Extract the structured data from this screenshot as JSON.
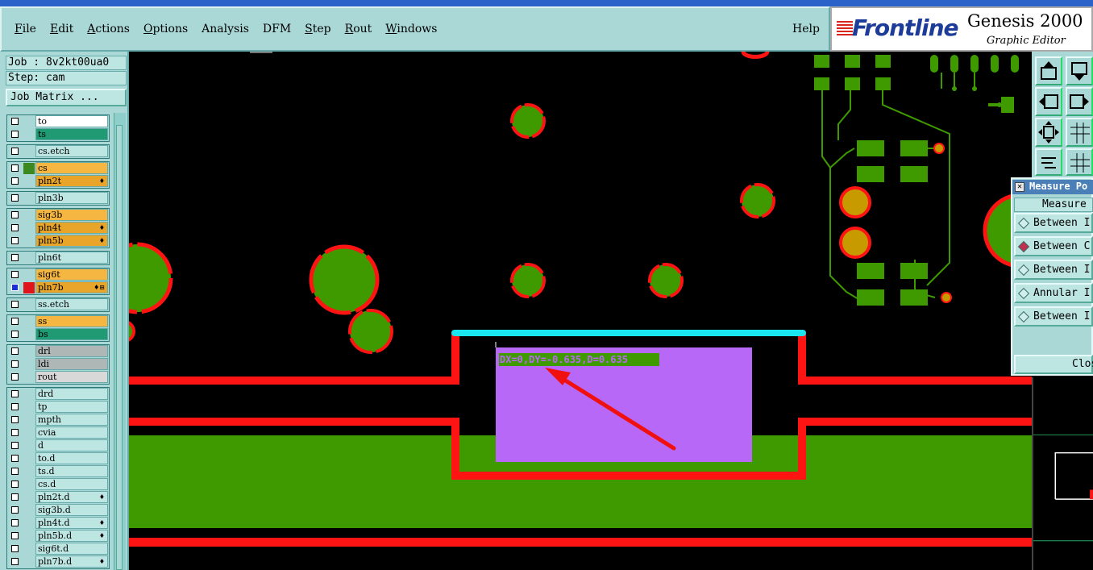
{
  "menubar": {
    "items": [
      {
        "label": "File",
        "u": "F",
        "rest": "ile"
      },
      {
        "label": "Edit",
        "u": "E",
        "rest": "dit"
      },
      {
        "label": "Actions",
        "u": "A",
        "rest": "ctions"
      },
      {
        "label": "Options",
        "u": "O",
        "rest": "ptions"
      },
      {
        "label": "Analysis",
        "u": "",
        "rest": "Analysis"
      },
      {
        "label": "DFM",
        "u": "",
        "rest": "DFM"
      },
      {
        "label": "Step",
        "u": "S",
        "rest": "tep"
      },
      {
        "label": "Rout",
        "u": "R",
        "rest": "out"
      },
      {
        "label": "Windows",
        "u": "W",
        "rest": "indows"
      }
    ],
    "help": "Help"
  },
  "brand": {
    "name": "Frontline",
    "product": "Genesis 2000",
    "subtitle": "Graphic Editor"
  },
  "job": {
    "job_label": "Job : 8v2kt00ua0",
    "step_label": "Step: cam",
    "matrix_button": "Job Matrix ..."
  },
  "layers": [
    {
      "group": 0,
      "name": "to",
      "color": "#ffffff",
      "mark": ""
    },
    {
      "group": 0,
      "name": "ts",
      "color": "#1f9a72",
      "mark": ""
    },
    {
      "group": 1,
      "name": "cs.etch",
      "color": "#bde6e3",
      "mark": ""
    },
    {
      "group": 2,
      "name": "cs",
      "color": "#f5b642",
      "mark": "",
      "sel": "#3c8a1f"
    },
    {
      "group": 2,
      "name": "pln2t",
      "color": "#e8a52a",
      "mark": "♦"
    },
    {
      "group": 3,
      "name": "pln3b",
      "color": "#bde6e3",
      "mark": ""
    },
    {
      "group": 4,
      "name": "sig3b",
      "color": "#f5b642",
      "mark": ""
    },
    {
      "group": 4,
      "name": "pln4t",
      "color": "#e8a52a",
      "mark": "♦"
    },
    {
      "group": 4,
      "name": "pln5b",
      "color": "#e8a52a",
      "mark": "♦"
    },
    {
      "group": 5,
      "name": "pln6t",
      "color": "#bde6e3",
      "mark": ""
    },
    {
      "group": 6,
      "name": "sig6t",
      "color": "#f5b642",
      "mark": ""
    },
    {
      "group": 6,
      "name": "pln7b",
      "color": "#e8a52a",
      "mark": "♦⊞",
      "sel": "#e0151b",
      "chk": "#1b2fd9"
    },
    {
      "group": 7,
      "name": "ss.etch",
      "color": "#bde6e3",
      "mark": ""
    },
    {
      "group": 8,
      "name": "ss",
      "color": "#f5b642",
      "mark": ""
    },
    {
      "group": 8,
      "name": "bs",
      "color": "#1f9a72",
      "mark": ""
    },
    {
      "group": 9,
      "name": "drl",
      "color": "#aeb6b6",
      "mark": ""
    },
    {
      "group": 9,
      "name": "ldi",
      "color": "#aeb6b6",
      "mark": ""
    },
    {
      "group": 9,
      "name": "rout",
      "color": "#d8d8d8",
      "mark": ""
    },
    {
      "group": 10,
      "name": "drd",
      "color": "#bde6e3",
      "mark": ""
    },
    {
      "group": 10,
      "name": "tp",
      "color": "#bde6e3",
      "mark": ""
    },
    {
      "group": 10,
      "name": "mpth",
      "color": "#bde6e3",
      "mark": ""
    },
    {
      "group": 10,
      "name": "cvia",
      "color": "#bde6e3",
      "mark": ""
    },
    {
      "group": 10,
      "name": "d",
      "color": "#bde6e3",
      "mark": ""
    },
    {
      "group": 10,
      "name": "to.d",
      "color": "#bde6e3",
      "mark": ""
    },
    {
      "group": 10,
      "name": "ts.d",
      "color": "#bde6e3",
      "mark": ""
    },
    {
      "group": 10,
      "name": "cs.d",
      "color": "#bde6e3",
      "mark": ""
    },
    {
      "group": 10,
      "name": "pln2t.d",
      "color": "#bde6e3",
      "mark": "♦"
    },
    {
      "group": 10,
      "name": "sig3b.d",
      "color": "#bde6e3",
      "mark": ""
    },
    {
      "group": 10,
      "name": "pln4t.d",
      "color": "#bde6e3",
      "mark": "♦"
    },
    {
      "group": 10,
      "name": "pln5b.d",
      "color": "#bde6e3",
      "mark": "♦"
    },
    {
      "group": 10,
      "name": "sig6t.d",
      "color": "#bde6e3",
      "mark": ""
    },
    {
      "group": 10,
      "name": "pln7b.d",
      "color": "#bde6e3",
      "mark": "♦"
    }
  ],
  "canvas": {
    "measure_readout": "DX=0,DY=-0.635,D=0.635",
    "colors": {
      "copper": "#3f9a00",
      "outline": "#ff1414",
      "measure_line": "#19e6f0",
      "highlight": "#b768f7",
      "pad": "#c79a00",
      "annotation_arrow": "#f01010"
    }
  },
  "measure_dialog": {
    "title": "Measure Po",
    "header": "Measure",
    "options": [
      "Between I",
      "Between C",
      "Between I",
      "Annular I",
      "Between I"
    ],
    "selected_index": 1,
    "close": "Clos"
  }
}
